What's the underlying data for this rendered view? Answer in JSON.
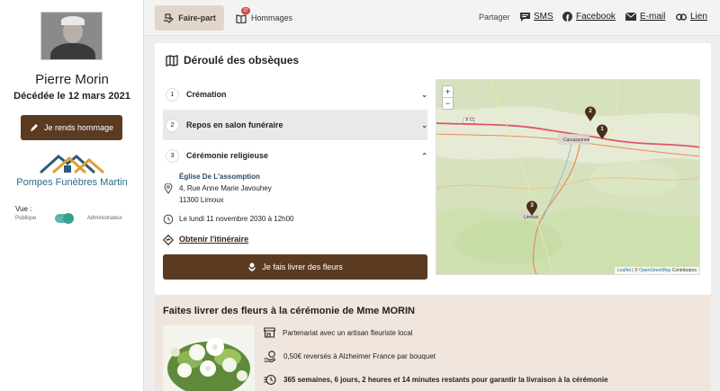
{
  "profile": {
    "name": "Pierre Morin",
    "death_date": "Décédée le 12 mars 2021",
    "tribute_button": "Je rends hommage",
    "brand_name": "Pompes Funèbres Martin",
    "view_label": "Vue :",
    "view_public": "Publique",
    "view_admin": "Administrateur",
    "view_mode": "admin"
  },
  "topbar": {
    "tabs": [
      {
        "label": "Faire-part",
        "active": true
      },
      {
        "label": "Hommages",
        "badge": "37"
      }
    ],
    "share_label": "Partager",
    "share_links": [
      {
        "label": "SMS",
        "icon": "chat-icon"
      },
      {
        "label": "Facebook",
        "icon": "facebook-icon"
      },
      {
        "label": "E-mail",
        "icon": "mail-icon"
      },
      {
        "label": "Lien",
        "icon": "link-icon"
      }
    ]
  },
  "funeral": {
    "title": "Déroulé des obsèques",
    "steps": [
      {
        "num": "1",
        "label": "Crémation"
      },
      {
        "num": "2",
        "label": "Repos en salon funéraire"
      },
      {
        "num": "3",
        "label": "Cérémonie religieuse"
      }
    ],
    "ceremony": {
      "place": "Église De L'assomption",
      "address_line1": "4, Rue Anne Marie Javouhey",
      "address_line2": "11300 Limoux",
      "datetime": "Le lundi 11 novembre 2030 à 12h00",
      "directions": "Obtenir l'itinéraire"
    },
    "flowers_button": "Je fais livrer des fleurs"
  },
  "map": {
    "zoom_in": "+",
    "zoom_out": "−",
    "road": "A 61",
    "cities": [
      "Carcassonne",
      "Limoux"
    ],
    "markers": [
      "1",
      "2",
      "3"
    ],
    "attribution_leaflet": "Leaflet",
    "attribution_sep": " | © ",
    "attribution_osm": "OpenStreetMap",
    "attribution_tail": " Contributors"
  },
  "flowers": {
    "title": "Faites livrer des fleurs à la cérémonie de Mme MORIN",
    "features": [
      {
        "icon": "shop-icon",
        "text": "Partenariat avec un artisan fleuriste local",
        "bold": false
      },
      {
        "icon": "donation-icon",
        "text": "0,50€ reversés à Alzheimer France par bouquet",
        "bold": false
      },
      {
        "icon": "timer-icon",
        "text": "365 semaines, 6 jours, 2 heures et 14 minutes restants pour garantir la livraison à la cérémonie",
        "bold": true
      }
    ]
  },
  "colors": {
    "primary_brown": "#5b3a22",
    "toggle_teal": "#36a190",
    "badge_red": "#d64545",
    "route_red": "#e0536a"
  }
}
